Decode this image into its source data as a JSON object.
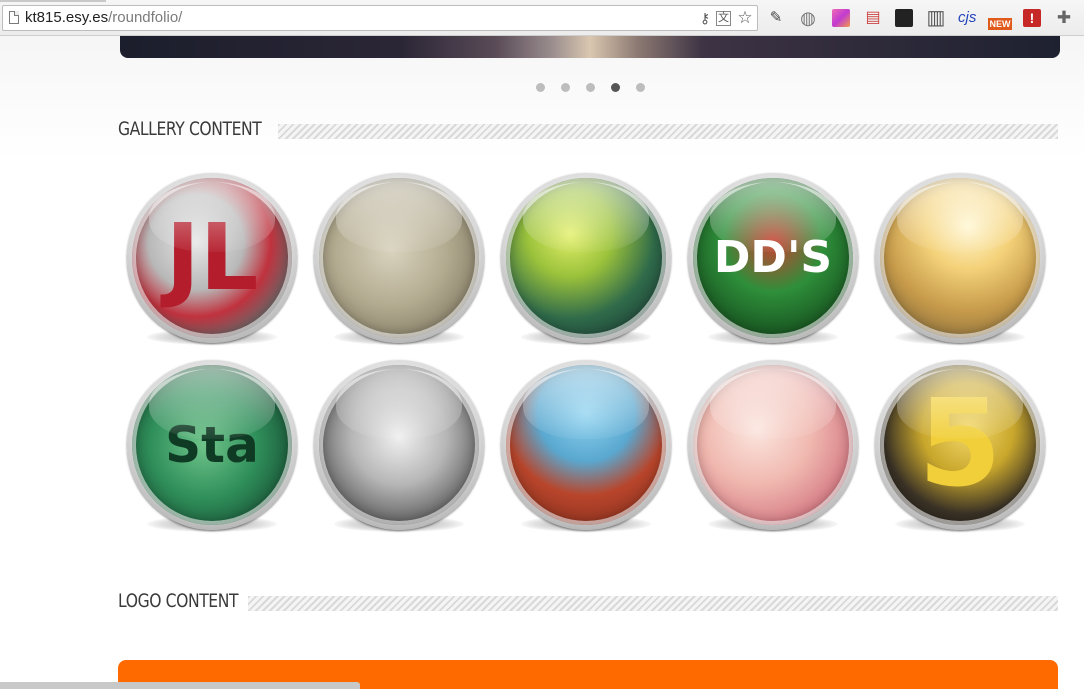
{
  "browser": {
    "url_host": "kt815.esy.es",
    "url_path": "/roundfolio/",
    "omnibox_icons": [
      "key-icon",
      "translate-icon",
      "star-icon"
    ],
    "extensions": [
      {
        "name": "eyedropper-icon",
        "glyph": "✎"
      },
      {
        "name": "globe-icon",
        "glyph": "◍"
      },
      {
        "name": "color-palette-icon",
        "color": "#d84fb0"
      },
      {
        "name": "notes-icon",
        "glyph": "▤"
      },
      {
        "name": "checklist-icon",
        "glyph": "☑"
      },
      {
        "name": "columns-icon",
        "glyph": "▥"
      },
      {
        "name": "cjs-icon",
        "text": "cjs"
      },
      {
        "name": "new-feed-icon",
        "text": "NEW"
      },
      {
        "name": "alert-icon",
        "glyph": "!"
      },
      {
        "name": "puzzle-icon",
        "glyph": "✚"
      }
    ]
  },
  "slider": {
    "dot_count": 5,
    "active_index": 3
  },
  "sections": {
    "gallery_title": "GALLERY CONTENT",
    "logo_title": "LOGO CONTENT"
  },
  "gallery": {
    "items": [
      {
        "name": "gallery-item-jl-typography",
        "bg": "radial-gradient(circle at 40% 40%, #e7e7e7 0%, #b8b8b8 35%, #c0323e 55%, #6a6a6a 75%, #2a2a2a 100%)",
        "glyph": "JL",
        "glyph_color": "#b41e2c"
      },
      {
        "name": "gallery-item-sketch-portrait",
        "bg": "radial-gradient(circle at 45% 45%, #d9d3bf 0%, #b3ab90 45%, #8a826a 75%, #5b5646 100%)",
        "glyph": "",
        "glyph_color": "#c23b2f"
      },
      {
        "name": "gallery-item-astronaut",
        "bg": "radial-gradient(circle at 40% 35%, #e4f06b 0%, #9bc23b 30%, #2f6a4a 60%, #162a2e 100%)",
        "glyph": "",
        "glyph_color": "#ffffff"
      },
      {
        "name": "gallery-item-beer-can",
        "bg": "radial-gradient(circle at 50% 40%, #c94032 0%, #2e8f3a 40%, #1c5e25 70%, #0e2d14 100%)",
        "glyph": "DD'S",
        "glyph_color": "#ffffff"
      },
      {
        "name": "gallery-item-sunset-lizard",
        "bg": "radial-gradient(circle at 55% 30%, #fff6d0 0%, #f4d27a 30%, #c69a4a 60%, #6b5a3a 100%)",
        "glyph": "",
        "glyph_color": "#4a4a4a"
      },
      {
        "name": "gallery-item-stay-green",
        "bg": "radial-gradient(circle at 45% 50%, #6fc48a 0%, #2f8f5a 45%, #1d5c3c 75%, #0d2a1c 100%)",
        "glyph": "Sta",
        "glyph_color": "#0f3a24"
      },
      {
        "name": "gallery-item-city-construction",
        "bg": "radial-gradient(circle at 50% 45%, #f0f0f0 0%, #b6b6b6 40%, #6b6b6b 70%, #2b2b2b 100%)",
        "glyph": "",
        "glyph_color": "#333333"
      },
      {
        "name": "gallery-item-guitar",
        "bg": "radial-gradient(circle at 50% 30%, #8fd3f0 0%, #5aa8d0 35%, #b8452b 60%, #7a2a1a 100%)",
        "glyph": "",
        "glyph_color": "#ffffff"
      },
      {
        "name": "gallery-item-woman-portrait",
        "bg": "radial-gradient(circle at 40% 40%, #fbe6df 0%, #f0b9b0 40%, #d9838a 70%, #9a4f5a 100%)",
        "glyph": "",
        "glyph_color": "#ffffff"
      },
      {
        "name": "gallery-item-number-five",
        "bg": "radial-gradient(circle at 55% 40%, #f3d96a 0%, #c9a72c 35%, #3a3226 65%, #15120c 100%)",
        "glyph": "5",
        "glyph_color": "#f1cf3a"
      }
    ]
  }
}
